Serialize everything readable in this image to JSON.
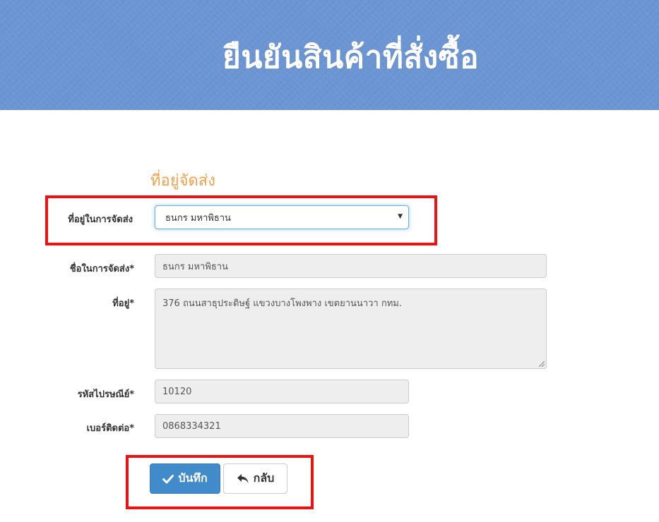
{
  "header": {
    "title": "ยืนยันสินค้าที่สั่งซื้อ"
  },
  "section": {
    "title": "ที่อยู่จัดส่ง"
  },
  "form": {
    "address_select": {
      "label": "ที่อยู่ในการจัดส่ง",
      "selected": "ธนกร มหาพิธาน"
    },
    "name": {
      "label": "ชื่อในการจัดส่ง*",
      "value": "ธนกร มหาพิธาน"
    },
    "address": {
      "label": "ที่อยู่*",
      "value": "376 ถนนสาธุประดิษฐ์ แขวงบางโพงพาง เขตยานนาวา กทม."
    },
    "postcode": {
      "label": "รหัสไปรษณีย์*",
      "value": "10120"
    },
    "phone": {
      "label": "เบอร์ติดต่อ*",
      "value": "0868334321"
    }
  },
  "buttons": {
    "save_label": "บันทึก",
    "back_label": "กลับ",
    "save_icon": "check-icon",
    "back_icon": "reply-arrow-icon"
  },
  "colors": {
    "banner": "#6b95d3",
    "section_title": "#f5a04a",
    "highlight": "#ee1111",
    "primary_button": "#428bca"
  }
}
